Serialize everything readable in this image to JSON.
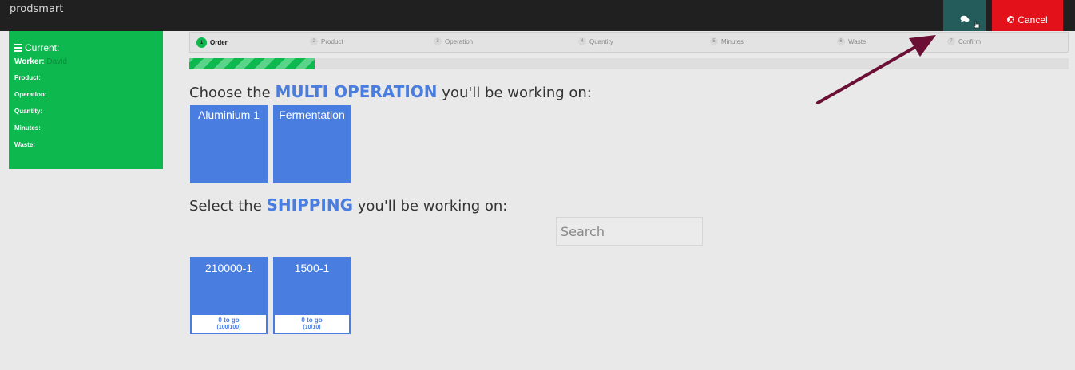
{
  "app": {
    "brand": "prodsmart"
  },
  "topbar": {
    "cancel_label": "Cancel",
    "chat_icon": "chat-icon",
    "colors": {
      "bar": "#202020",
      "chat": "#245c5c",
      "cancel": "#e3121a"
    }
  },
  "current": {
    "title": "Current:",
    "worker_label": "Worker:",
    "worker_name": "David",
    "fields": [
      "Product:",
      "Operation:",
      "Quantity:",
      "Minutes:",
      "Waste:"
    ],
    "color": "#0db84f"
  },
  "steps": [
    {
      "num": "1",
      "label": "Order"
    },
    {
      "num": "2",
      "label": "Product"
    },
    {
      "num": "3",
      "label": "Operation"
    },
    {
      "num": "4",
      "label": "Quantity"
    },
    {
      "num": "5",
      "label": "Minutes"
    },
    {
      "num": "6",
      "label": "Waste"
    },
    {
      "num": "7",
      "label": "Confirm"
    }
  ],
  "active_step": 1,
  "progress_fraction": 0.143,
  "operation_section": {
    "prefix": "Choose the",
    "emphasis": "MULTI OPERATION",
    "suffix": "you'll be working on:",
    "options": [
      "Aluminium 1",
      "Fermentation"
    ]
  },
  "shipping_section": {
    "prefix": "Select the",
    "emphasis": "SHIPPING",
    "suffix": "you'll be working on:",
    "search_placeholder": "Search",
    "options": [
      {
        "code": "210000-1",
        "togo": "0 to go",
        "count": "(100/100)"
      },
      {
        "code": "1500-1",
        "togo": "0 to go",
        "count": "(10/10)"
      }
    ]
  },
  "accent_color": "#4a7de0",
  "annotation_arrow_color": "#6b0f35"
}
